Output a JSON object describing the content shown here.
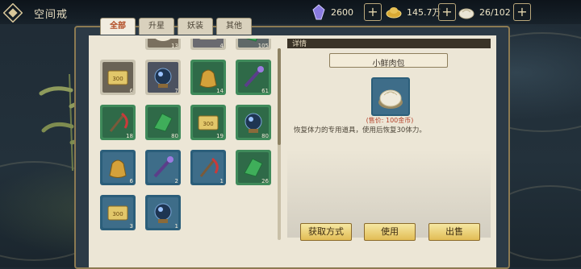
{
  "header": {
    "title": "空间戒",
    "resources": [
      {
        "icon": "crystal-icon",
        "value": "2600"
      },
      {
        "icon": "gold-ingot-icon",
        "value": "145.7万"
      },
      {
        "icon": "bun-icon",
        "value": "26/102"
      }
    ]
  },
  "tabs": [
    {
      "label": "全部"
    },
    {
      "label": "升星"
    },
    {
      "label": "妖装"
    },
    {
      "label": "其他"
    }
  ],
  "inventory": {
    "slots": [
      {
        "frame": "#c9c3b0",
        "fill": "#7a705f",
        "icon": "bun-icon",
        "count": "13"
      },
      {
        "frame": "#c9c3b0",
        "fill": "#6a6a70",
        "icon": "scroll-icon",
        "count": "4"
      },
      {
        "frame": "#c9c3b0",
        "fill": "#5f6868",
        "icon": "cloth-icon",
        "count": "105"
      },
      {
        "frame": "#c9c3b0",
        "fill": "#6a6356",
        "icon": "coupon-icon",
        "count": "6"
      },
      {
        "frame": "#c9c3b0",
        "fill": "#4c5260",
        "icon": "orb-icon",
        "count": "7"
      },
      {
        "frame": "#3f8a5a",
        "fill": "#2f6a48",
        "icon": "money-bag-icon",
        "count": "14"
      },
      {
        "frame": "#3f8a5a",
        "fill": "#2f6a48",
        "icon": "wand-icon",
        "count": "61"
      },
      {
        "frame": "#3f8a5a",
        "fill": "#2f6a48",
        "icon": "scythe-icon",
        "count": "18"
      },
      {
        "frame": "#3f8a5a",
        "fill": "#2f6a48",
        "icon": "cloth-icon",
        "count": "80"
      },
      {
        "frame": "#3f8a5a",
        "fill": "#2f6a48",
        "icon": "coupon-icon",
        "count": "19"
      },
      {
        "frame": "#3f8a5a",
        "fill": "#2f6a48",
        "icon": "orb-icon",
        "count": "80"
      },
      {
        "frame": "#2b5e7a",
        "fill": "#3e6d89",
        "icon": "money-bag-icon",
        "count": "6"
      },
      {
        "frame": "#2b5e7a",
        "fill": "#3e6d89",
        "icon": "wand-icon",
        "count": "2"
      },
      {
        "frame": "#2b5e7a",
        "fill": "#3e6d89",
        "icon": "scythe-icon",
        "count": "1"
      },
      {
        "frame": "#3f8a5a",
        "fill": "#2f6a48",
        "icon": "cloth-icon",
        "count": "26"
      },
      {
        "frame": "#2b5e7a",
        "fill": "#3e6d89",
        "icon": "coupon-icon",
        "count": "3"
      },
      {
        "frame": "#2b5e7a",
        "fill": "#3e6d89",
        "icon": "orb-icon",
        "count": "1"
      }
    ]
  },
  "detail": {
    "section_label": "详情",
    "item_name": "小鲜肉包",
    "item_icon": "bun-icon",
    "price": "(售价: 100金币)",
    "description": "恢复体力的专用道具，使用后恢复30体力。"
  },
  "actions": {
    "acquire_label": "获取方式",
    "use_label": "使用",
    "sell_label": "出售"
  },
  "colors": {
    "accent_red": "#b14a22",
    "button_gold": "#e2bd55",
    "frame_gold": "#8c7a52"
  }
}
